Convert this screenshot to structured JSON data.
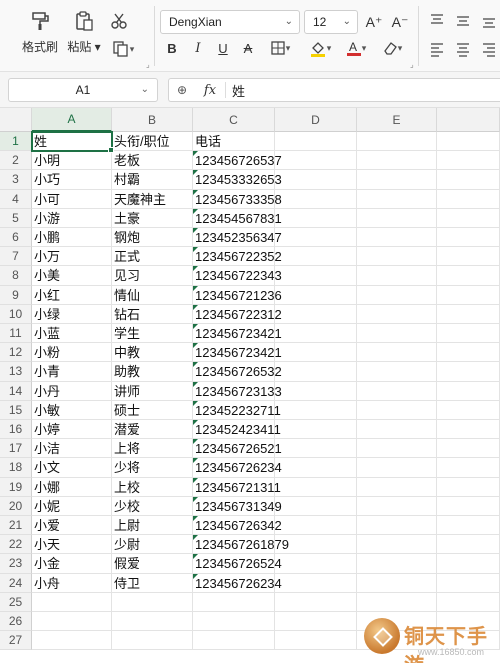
{
  "ribbon": {
    "format_painter_label": "格式刷",
    "paste_label": "粘贴",
    "font_name": "DengXian",
    "font_size": "12",
    "increase_font": "A⁺",
    "decrease_font": "A⁻",
    "bold": "B",
    "italic": "I",
    "underline": "U",
    "strike": "A",
    "font_color_accent": "#d32f2f",
    "fill_color_accent": "#f6d100"
  },
  "formula_bar": {
    "cell_ref": "A1",
    "fx": "fx",
    "content": "姓"
  },
  "sheet": {
    "columns": [
      "A",
      "B",
      "C",
      "D",
      "E"
    ],
    "header_row": [
      "姓",
      "头衔/职位",
      "电话"
    ],
    "rows": [
      [
        "小明",
        "老板",
        "123456726537"
      ],
      [
        "小巧",
        "村霸",
        "123453332653"
      ],
      [
        "小可",
        "天魔神主",
        "123456733358"
      ],
      [
        "小游",
        "土豪",
        "123454567831"
      ],
      [
        "小鹏",
        "钢炮",
        "123452356347"
      ],
      [
        "小万",
        "正式",
        "123456722352"
      ],
      [
        "小美",
        "见习",
        "123456722343"
      ],
      [
        "小红",
        "情仙",
        "123456721236"
      ],
      [
        "小绿",
        "钻石",
        "123456722312"
      ],
      [
        "小蓝",
        "学生",
        "123456723421"
      ],
      [
        "小粉",
        "中教",
        "123456723421"
      ],
      [
        "小青",
        "助教",
        "123456726532"
      ],
      [
        "小丹",
        "讲师",
        "123456723133"
      ],
      [
        "小敏",
        "硕士",
        "123452232711"
      ],
      [
        "小婷",
        "潜爱",
        "123452423411"
      ],
      [
        "小洁",
        "上将",
        "123456726521"
      ],
      [
        "小文",
        "少将",
        "123456726234"
      ],
      [
        "小娜",
        "上校",
        "123456721311"
      ],
      [
        "小妮",
        "少校",
        "123456731349"
      ],
      [
        "小爱",
        "上尉",
        "123456726342"
      ],
      [
        "小天",
        "少尉",
        "1234567261879"
      ],
      [
        "小金",
        "假爱",
        "123456726524"
      ],
      [
        "小舟",
        "侍卫",
        "123456726234"
      ]
    ],
    "row_numbers": [
      "1",
      "2",
      "3",
      "4",
      "5",
      "6",
      "7",
      "8",
      "9",
      "10",
      "11",
      "12",
      "13",
      "14",
      "15",
      "16",
      "17",
      "18",
      "19",
      "20",
      "21",
      "22",
      "23",
      "24",
      "25",
      "26",
      "27"
    ],
    "active_cell": "A1"
  },
  "watermark": {
    "brand": "铜天下手游",
    "site": "www.16850.com"
  }
}
